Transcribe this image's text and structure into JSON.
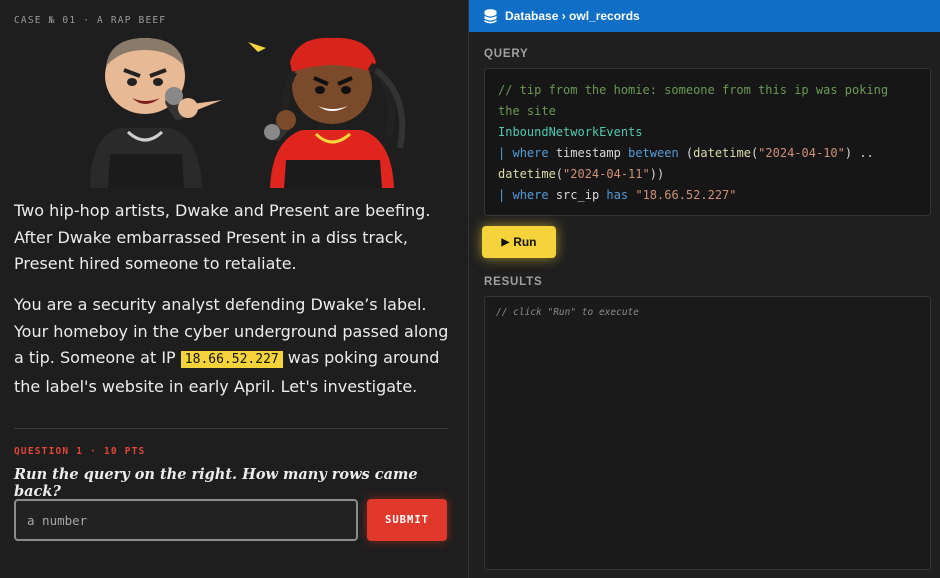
{
  "case": {
    "label": "CASE № 01 · A RAP BEEF"
  },
  "story": {
    "paragraph1": "Two hip-hop artists, Dwake and Present are beefing. After Dwake embarrassed Present in a diss track, Present hired someone to retaliate.",
    "paragraph2_before": "You are a security analyst defending Dwake’s label. Your homeboy in the cyber underground passed along a tip. Someone at IP ",
    "ip": "18.66.52.227",
    "paragraph2_after": " was poking around the label's website in early April. Let's investigate."
  },
  "question": {
    "label": "QUESTION 1 · 10 PTS",
    "text": "Run the query on the right. How many rows came back?",
    "input_placeholder": "a number",
    "input_value": "",
    "submit_label": "SUBMIT"
  },
  "database": {
    "icon": "database-icon",
    "title": "Database › owl_records"
  },
  "query": {
    "label": "QUERY",
    "line1_comment": "// tip from the homie: someone from this ip was poking the site",
    "line2_table": "InboundNetworkEvents",
    "line3_pipe": "|",
    "line3_kw_where": "where",
    "line3_field": "timestamp",
    "line3_kw_between": "between",
    "line3_open": "(",
    "line3_fn1": "datetime",
    "line3_p1": "(",
    "line3_str1": "\"2024-04-10\"",
    "line3_p2": ") ..",
    "line4_fn2": "datetime",
    "line4_p1": "(",
    "line4_str2": "\"2024-04-11\"",
    "line4_p2": "))",
    "line5_pipe": "|",
    "line5_kw_where": "where",
    "line5_field": "src_ip",
    "line5_kw_has": "has",
    "line5_str": "\"18.66.52.227\""
  },
  "run": {
    "label": "Run",
    "icon": "play-icon"
  },
  "results": {
    "label": "RESULTS",
    "placeholder": "// click \"Run\" to execute"
  },
  "colors": {
    "header_blue": "#0f6fc6",
    "accent_yellow": "#f5d33a",
    "accent_red": "#e0392c"
  }
}
